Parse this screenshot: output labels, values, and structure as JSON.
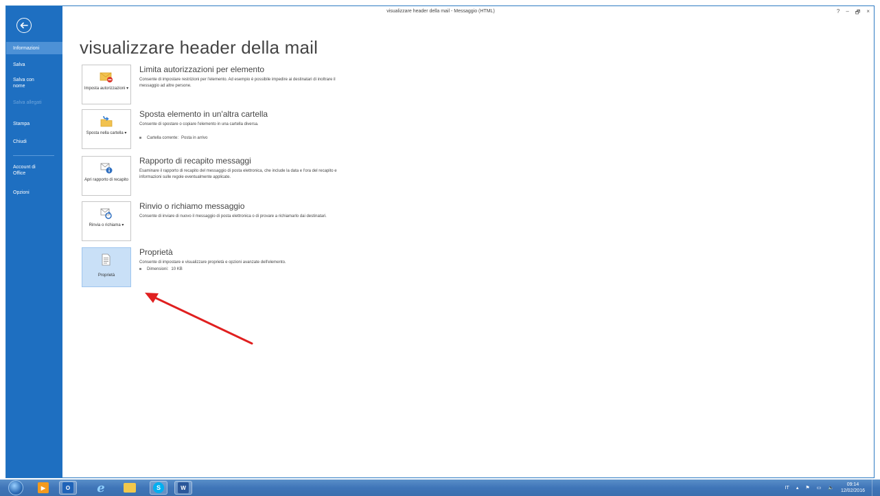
{
  "window": {
    "title": "visualizzare header della mail - Messaggio (HTML)",
    "controls": {
      "help": "?",
      "minimize": "–",
      "restore": "🗗",
      "close": "×"
    }
  },
  "sidebar": {
    "back_icon": "back-arrow-icon",
    "items": [
      {
        "label": "Informazioni",
        "state": "active"
      },
      {
        "label": "Salva",
        "state": "normal"
      },
      {
        "label": "Salva con nome",
        "state": "normal"
      },
      {
        "label": "Salva allegati",
        "state": "disabled"
      },
      {
        "label": "Stampa",
        "state": "normal"
      },
      {
        "label": "Chiudi",
        "state": "normal"
      },
      {
        "label": "Account di Office",
        "state": "normal"
      },
      {
        "label": "Opzioni",
        "state": "normal"
      }
    ]
  },
  "main": {
    "title": "visualizzare header della mail",
    "actions": [
      {
        "tile_label": "Imposta autorizzazioni ▾",
        "icon": "envelope-restrict-icon",
        "title": "Limita autorizzazioni per elemento",
        "description": "Consente di impostare restrizioni per l'elemento. Ad esempio è possibile impedire ai destinatari di inoltrare il messaggio ad altre persone."
      },
      {
        "tile_label": "Sposta nella cartella ▾",
        "icon": "folder-move-icon",
        "title": "Sposta elemento in un'altra cartella",
        "description": "Consente di spostare o copiare l'elemento in una cartella diversa.",
        "meta_label": "Cartella corrente:",
        "meta_value": "Posta in arrivo"
      },
      {
        "tile_label": "Apri rapporto di recapito",
        "icon": "delivery-report-icon",
        "title": "Rapporto di recapito messaggi",
        "description": "Esaminare il rapporto di recapito del messaggio di posta elettronica, che include la data e l'ora del recapito e informazioni sulle regole eventualmente applicate."
      },
      {
        "tile_label": "Rinvia o richiama ▾",
        "icon": "resend-recall-icon",
        "title": "Rinvio o richiamo messaggio",
        "description": "Consente di inviare di nuovo il messaggio di posta elettronica o di provare a richiamarlo dai destinatari."
      },
      {
        "tile_label": "Proprietà",
        "icon": "properties-icon",
        "title": "Proprietà",
        "description": "Consente di impostare e visualizzare proprietà e opzioni avanzate dell'elemento.",
        "meta_label": "Dimensioni:",
        "meta_value": "10 KB",
        "selected": true
      }
    ]
  },
  "annotation": {
    "color": "#e02020",
    "points_to": "Proprietà"
  },
  "taskbar": {
    "pinned": [
      {
        "name": "media-player-icon",
        "glyph": "▶",
        "color": "#f39a1e"
      },
      {
        "name": "outlook-icon",
        "glyph": "O",
        "color": "#1f63b8",
        "active": true
      },
      {
        "name": "internet-explorer-icon",
        "glyph": "e",
        "color": "#3fa9f5"
      },
      {
        "name": "file-explorer-icon",
        "glyph": "▬",
        "color": "#f2c84b"
      },
      {
        "name": "skype-icon",
        "glyph": "S",
        "color": "#00aff0",
        "active": true
      },
      {
        "name": "word-icon",
        "glyph": "W",
        "color": "#2b579a",
        "active": true
      }
    ],
    "tray": {
      "language": "IT",
      "time": "09:14",
      "date": "12/02/2016"
    }
  },
  "colors": {
    "sidebar_bg": "#1e6fc1",
    "sidebar_active": "#4d91d6",
    "tile_selected": "#c9e0f7"
  }
}
